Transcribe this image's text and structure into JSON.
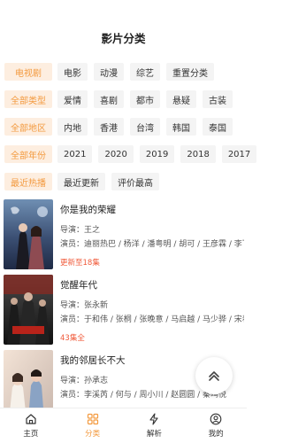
{
  "header": {
    "title": "影片分类"
  },
  "filters": [
    {
      "label": "电视剧",
      "options": [
        "电影",
        "动漫",
        "综艺",
        "重置分类"
      ]
    },
    {
      "label": "全部类型",
      "options": [
        "爱情",
        "喜剧",
        "都市",
        "悬疑",
        "古装"
      ]
    },
    {
      "label": "全部地区",
      "options": [
        "内地",
        "香港",
        "台湾",
        "韩国",
        "泰国"
      ]
    },
    {
      "label": "全部年份",
      "options": [
        "2021",
        "2020",
        "2019",
        "2018",
        "2017"
      ]
    },
    {
      "label": "最近热播",
      "options": [
        "最近更新",
        "评价最高"
      ]
    }
  ],
  "movies": [
    {
      "title": "你是我的荣耀",
      "director": "导演：王之",
      "cast": "演员：迪丽热巴 / 杨洋 / 潘粤明 / 胡可 / 王彦霖 / 李飞 / 张萌",
      "status": "更新至18集"
    },
    {
      "title": "觉醒年代",
      "director": "导演：张永新",
      "cast": "演员：于和伟 / 张桐 / 张晚意 / 马启越 / 马少骅 / 宋春丽",
      "status": "43集全"
    },
    {
      "title": "我的邻居长不大",
      "director": "导演：孙承志",
      "cast": "演员：李溪芮 / 何与 / 周小川 / 赵圆圆 / 秦鸣悦",
      "status": ""
    }
  ],
  "tabs": [
    {
      "label": "主页",
      "icon": "home-icon"
    },
    {
      "label": "分类",
      "icon": "category-icon"
    },
    {
      "label": "解析",
      "icon": "lightning-icon"
    },
    {
      "label": "我的",
      "icon": "user-icon"
    }
  ],
  "colors": {
    "accent": "#f39a3f",
    "accent_bg": "#fdeee0",
    "status": "#f05a3a"
  }
}
